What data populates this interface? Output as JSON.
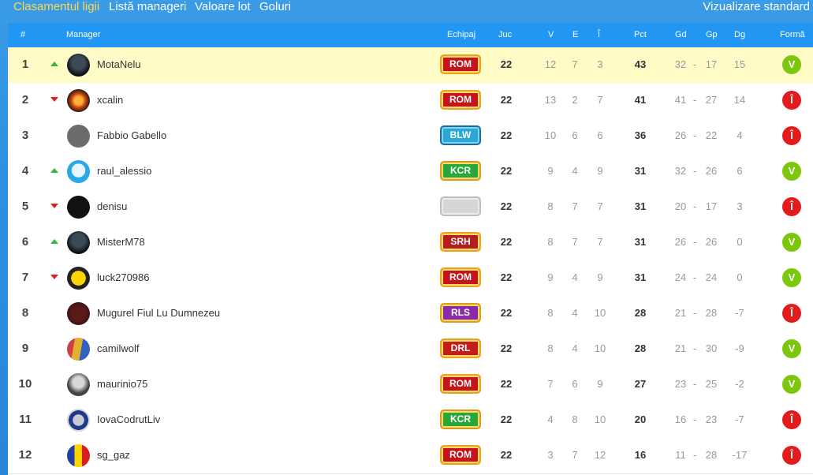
{
  "nav": {
    "tabs": [
      {
        "label": "Clasamentul ligii",
        "active": true
      },
      {
        "label": "Listă manageri",
        "active": false
      },
      {
        "label": "Valoare lot",
        "active": false
      },
      {
        "label": "Goluri",
        "active": false
      }
    ],
    "view_label": "Vizualizare standard"
  },
  "table": {
    "headers": {
      "rank": "#",
      "manager": "Manager",
      "team": "Echipaj",
      "played": "Juc",
      "won": "V",
      "drawn": "E",
      "lost": "Î",
      "points": "Pct",
      "goals_for": "Gd",
      "goals_against": "Gp",
      "goal_diff": "Dg",
      "form": "Formă"
    },
    "rows": [
      {
        "rank": "1",
        "trend": "up",
        "avatar_icon": "dark-robot-avatar",
        "name": "MotaNelu",
        "team": "ROM",
        "played": "22",
        "won": "12",
        "drawn": "7",
        "lost": "3",
        "points": "43",
        "gf": "32",
        "sep": "-",
        "ga": "17",
        "gd": "15",
        "form": "V",
        "highlight": true
      },
      {
        "rank": "2",
        "trend": "down",
        "avatar_icon": "fire-x-avatar",
        "name": "xcalin",
        "team": "ROM",
        "played": "22",
        "won": "13",
        "drawn": "2",
        "lost": "7",
        "points": "41",
        "gf": "41",
        "sep": "-",
        "ga": "27",
        "gd": "14",
        "form": "Î"
      },
      {
        "rank": "3",
        "trend": "",
        "avatar_icon": "gray-avatar",
        "name": "Fabbio Gabello",
        "team": "BLW",
        "played": "22",
        "won": "10",
        "drawn": "6",
        "lost": "6",
        "points": "36",
        "gf": "26",
        "sep": "-",
        "ga": "22",
        "gd": "4",
        "form": "Î"
      },
      {
        "rank": "4",
        "trend": "up",
        "avatar_icon": "state-support-avatar",
        "name": "raul_alessio",
        "team": "KCR",
        "played": "22",
        "won": "9",
        "drawn": "4",
        "lost": "9",
        "points": "31",
        "gf": "32",
        "sep": "-",
        "ga": "26",
        "gd": "6",
        "form": "V"
      },
      {
        "rank": "5",
        "trend": "down",
        "avatar_icon": "skull-avatar",
        "name": "denisu",
        "team": "",
        "played": "22",
        "won": "8",
        "drawn": "7",
        "lost": "7",
        "points": "31",
        "gf": "20",
        "sep": "-",
        "ga": "17",
        "gd": "3",
        "form": "Î"
      },
      {
        "rank": "6",
        "trend": "up",
        "avatar_icon": "dark-avatar",
        "name": "MisterM78",
        "team": "SRH",
        "played": "22",
        "won": "8",
        "drawn": "7",
        "lost": "7",
        "points": "31",
        "gf": "26",
        "sep": "-",
        "ga": "26",
        "gd": "0",
        "form": "V"
      },
      {
        "rank": "7",
        "trend": "down",
        "avatar_icon": "yellow-avatar",
        "name": "luck270986",
        "team": "ROM",
        "played": "22",
        "won": "9",
        "drawn": "4",
        "lost": "9",
        "points": "31",
        "gf": "24",
        "sep": "-",
        "ga": "24",
        "gd": "0",
        "form": "V"
      },
      {
        "rank": "8",
        "trend": "",
        "avatar_icon": "red-dark-avatar",
        "name": "Mugurel Fiul Lu Dumnezeu",
        "team": "RLS",
        "played": "22",
        "won": "8",
        "drawn": "4",
        "lost": "10",
        "points": "28",
        "gf": "21",
        "sep": "-",
        "ga": "28",
        "gd": "-7",
        "form": "Î"
      },
      {
        "rank": "9",
        "trend": "",
        "avatar_icon": "stripes-avatar",
        "name": "camilwolf",
        "team": "DRL",
        "played": "22",
        "won": "8",
        "drawn": "4",
        "lost": "10",
        "points": "28",
        "gf": "21",
        "sep": "-",
        "ga": "30",
        "gd": "-9",
        "form": "V"
      },
      {
        "rank": "10",
        "trend": "",
        "avatar_icon": "mug-avatar",
        "name": "maurinio75",
        "team": "ROM",
        "played": "22",
        "won": "7",
        "drawn": "6",
        "lost": "9",
        "points": "27",
        "gf": "23",
        "sep": "-",
        "ga": "25",
        "gd": "-2",
        "form": "V"
      },
      {
        "rank": "11",
        "trend": "",
        "avatar_icon": "crest-avatar",
        "name": "IovaCodrutLiv",
        "team": "KCR",
        "played": "22",
        "won": "4",
        "drawn": "8",
        "lost": "10",
        "points": "20",
        "gf": "16",
        "sep": "-",
        "ga": "23",
        "gd": "-7",
        "form": "Î"
      },
      {
        "rank": "12",
        "trend": "",
        "avatar_icon": "romania-flag-avatar",
        "name": "sg_gaz",
        "team": "ROM",
        "played": "22",
        "won": "3",
        "drawn": "7",
        "lost": "12",
        "points": "16",
        "gf": "11",
        "sep": "-",
        "ga": "28",
        "gd": "-17",
        "form": "Î"
      }
    ]
  },
  "colors": {
    "header_bg": "#2196f3",
    "highlight_row": "#fffbc7",
    "form_win": "#7ac70c",
    "form_loss": "#e31b1b",
    "trend_up": "#3cb43c",
    "trend_down": "#e02020",
    "active_tab": "#ffd84a"
  }
}
